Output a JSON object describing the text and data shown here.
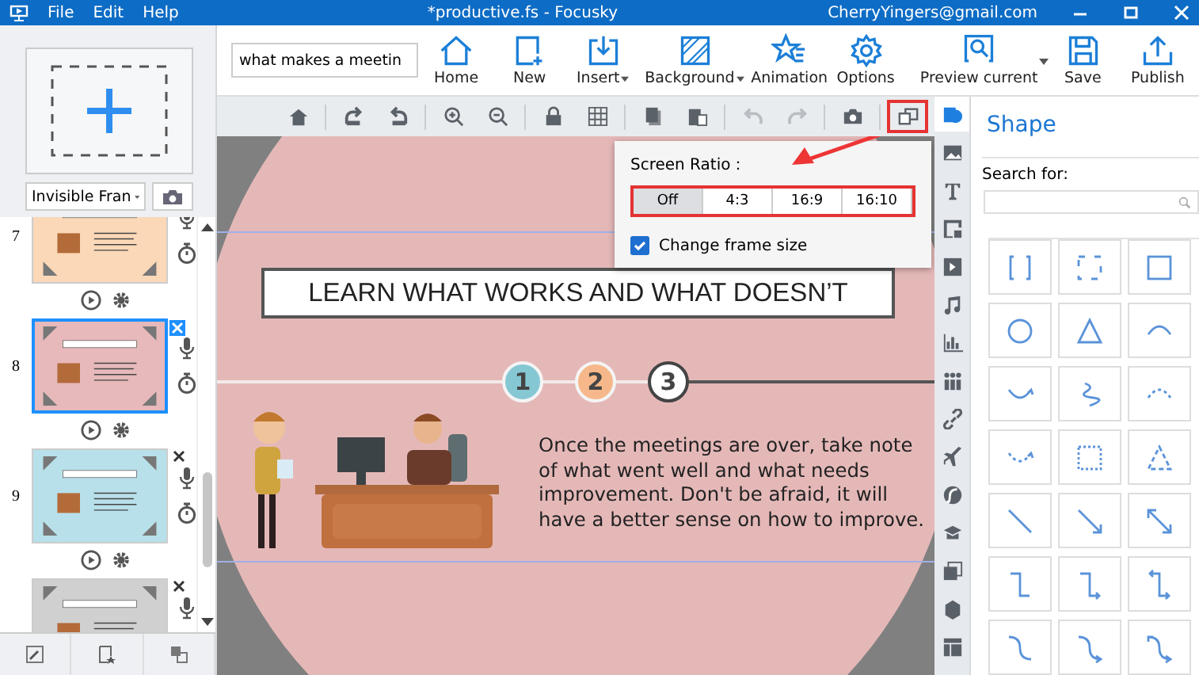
{
  "window": {
    "title": "*productive.fs - Focusky",
    "account": "CherryYingers@gmail.com"
  },
  "menu": [
    "File",
    "Edit",
    "Help"
  ],
  "search": {
    "value": "what makes a meetin"
  },
  "ribbon": [
    {
      "kind": "home",
      "label": "Home",
      "dropdown": false
    },
    {
      "kind": "new",
      "label": "New",
      "dropdown": false
    },
    {
      "kind": "insert",
      "label": "Insert",
      "dropdown": true
    },
    {
      "kind": "background",
      "label": "Background",
      "dropdown": true
    },
    {
      "kind": "animation",
      "label": "Animation",
      "dropdown": false
    },
    {
      "kind": "options",
      "label": "Options",
      "dropdown": false
    },
    {
      "kind": "preview",
      "label": "Preview current",
      "dropdown": true
    },
    {
      "kind": "save",
      "label": "Save",
      "dropdown": false
    },
    {
      "kind": "publish",
      "label": "Publish",
      "dropdown": false
    }
  ],
  "left_panel": {
    "frame_type": "Invisible Fran",
    "slides": [
      {
        "number": "7",
        "selected": false,
        "color": "#fbd8b8"
      },
      {
        "number": "8",
        "selected": true,
        "color": "#e7b9ba"
      },
      {
        "number": "9",
        "selected": false,
        "color": "#b8e0ea"
      },
      {
        "selected": false,
        "color": "#d0d0d0"
      }
    ]
  },
  "tools": [
    {
      "kind": "home",
      "disabled": false,
      "highlighted": false
    },
    {
      "kind": "separator"
    },
    {
      "kind": "forward",
      "disabled": false,
      "highlighted": false
    },
    {
      "kind": "backward",
      "disabled": false,
      "highlighted": false
    },
    {
      "kind": "separator"
    },
    {
      "kind": "zoom-in",
      "disabled": false,
      "highlighted": false
    },
    {
      "kind": "zoom-out",
      "disabled": false,
      "highlighted": false
    },
    {
      "kind": "separator"
    },
    {
      "kind": "lock",
      "disabled": false,
      "highlighted": false
    },
    {
      "kind": "grid",
      "disabled": false,
      "highlighted": false
    },
    {
      "kind": "separator"
    },
    {
      "kind": "copy",
      "disabled": false,
      "highlighted": false
    },
    {
      "kind": "paste",
      "disabled": false,
      "highlighted": false
    },
    {
      "kind": "separator"
    },
    {
      "kind": "undo",
      "disabled": true,
      "highlighted": false
    },
    {
      "kind": "redo",
      "disabled": true,
      "highlighted": false
    },
    {
      "kind": "separator"
    },
    {
      "kind": "camera",
      "disabled": false,
      "highlighted": false
    },
    {
      "kind": "separator"
    },
    {
      "kind": "ratio",
      "disabled": false,
      "highlighted": true
    }
  ],
  "popup": {
    "title": "Screen Ratio：",
    "highlighted": true,
    "ratios": [
      {
        "label": "Off",
        "selected": true
      },
      {
        "label": "4:3",
        "selected": false
      },
      {
        "label": "16:9",
        "selected": false
      },
      {
        "label": "16:10",
        "selected": false
      }
    ],
    "change_frame_size": {
      "label": "Change frame size",
      "checked": true
    }
  },
  "slide": {
    "title": "LEARN WHAT WORKS AND WHAT DOESN’T",
    "steps": [
      {
        "label": "1",
        "color": "#86c7d4"
      },
      {
        "label": "2",
        "color": "#f6b88a"
      },
      {
        "label": "3",
        "color": "#ffffff"
      }
    ],
    "body": "Once the meetings are over, take note of what went well and what needs improvement. Don't be afraid, it will have a better sense on how to improve."
  },
  "side_tabs": [
    {
      "kind": "shape",
      "selected": true
    },
    {
      "kind": "image",
      "selected": false
    },
    {
      "kind": "text",
      "selected": false
    },
    {
      "kind": "frame",
      "selected": false
    },
    {
      "kind": "video",
      "selected": false
    },
    {
      "kind": "music",
      "selected": false
    },
    {
      "kind": "chart",
      "selected": false
    },
    {
      "kind": "people",
      "selected": false
    },
    {
      "kind": "link",
      "selected": false
    },
    {
      "kind": "plane",
      "selected": false
    },
    {
      "kind": "flash",
      "selected": false
    },
    {
      "kind": "hat",
      "selected": false
    },
    {
      "kind": "gallery",
      "selected": false
    },
    {
      "kind": "cube",
      "selected": false
    },
    {
      "kind": "layout",
      "selected": false
    }
  ],
  "shape_panel": {
    "title": "Shape",
    "search_label": "Search for:",
    "shapes": [
      {
        "kind": "bracket"
      },
      {
        "kind": "dashed-rect"
      },
      {
        "kind": "rect"
      },
      {
        "kind": "circle"
      },
      {
        "kind": "triangle"
      },
      {
        "kind": "arc"
      },
      {
        "kind": "arrow-arc"
      },
      {
        "kind": "squiggle"
      },
      {
        "kind": "dashed-arc"
      },
      {
        "kind": "dashed-arrow-arc"
      },
      {
        "kind": "dotted-rect"
      },
      {
        "kind": "dashed-triangle"
      },
      {
        "kind": "line"
      },
      {
        "kind": "arrow-line"
      },
      {
        "kind": "double-arrow-line"
      },
      {
        "kind": "elbow"
      },
      {
        "kind": "elbow-arrow"
      },
      {
        "kind": "elbow-double-arrow"
      },
      {
        "kind": "curve"
      },
      {
        "kind": "curve-arrow"
      },
      {
        "kind": "curve-double-arrow"
      }
    ]
  }
}
